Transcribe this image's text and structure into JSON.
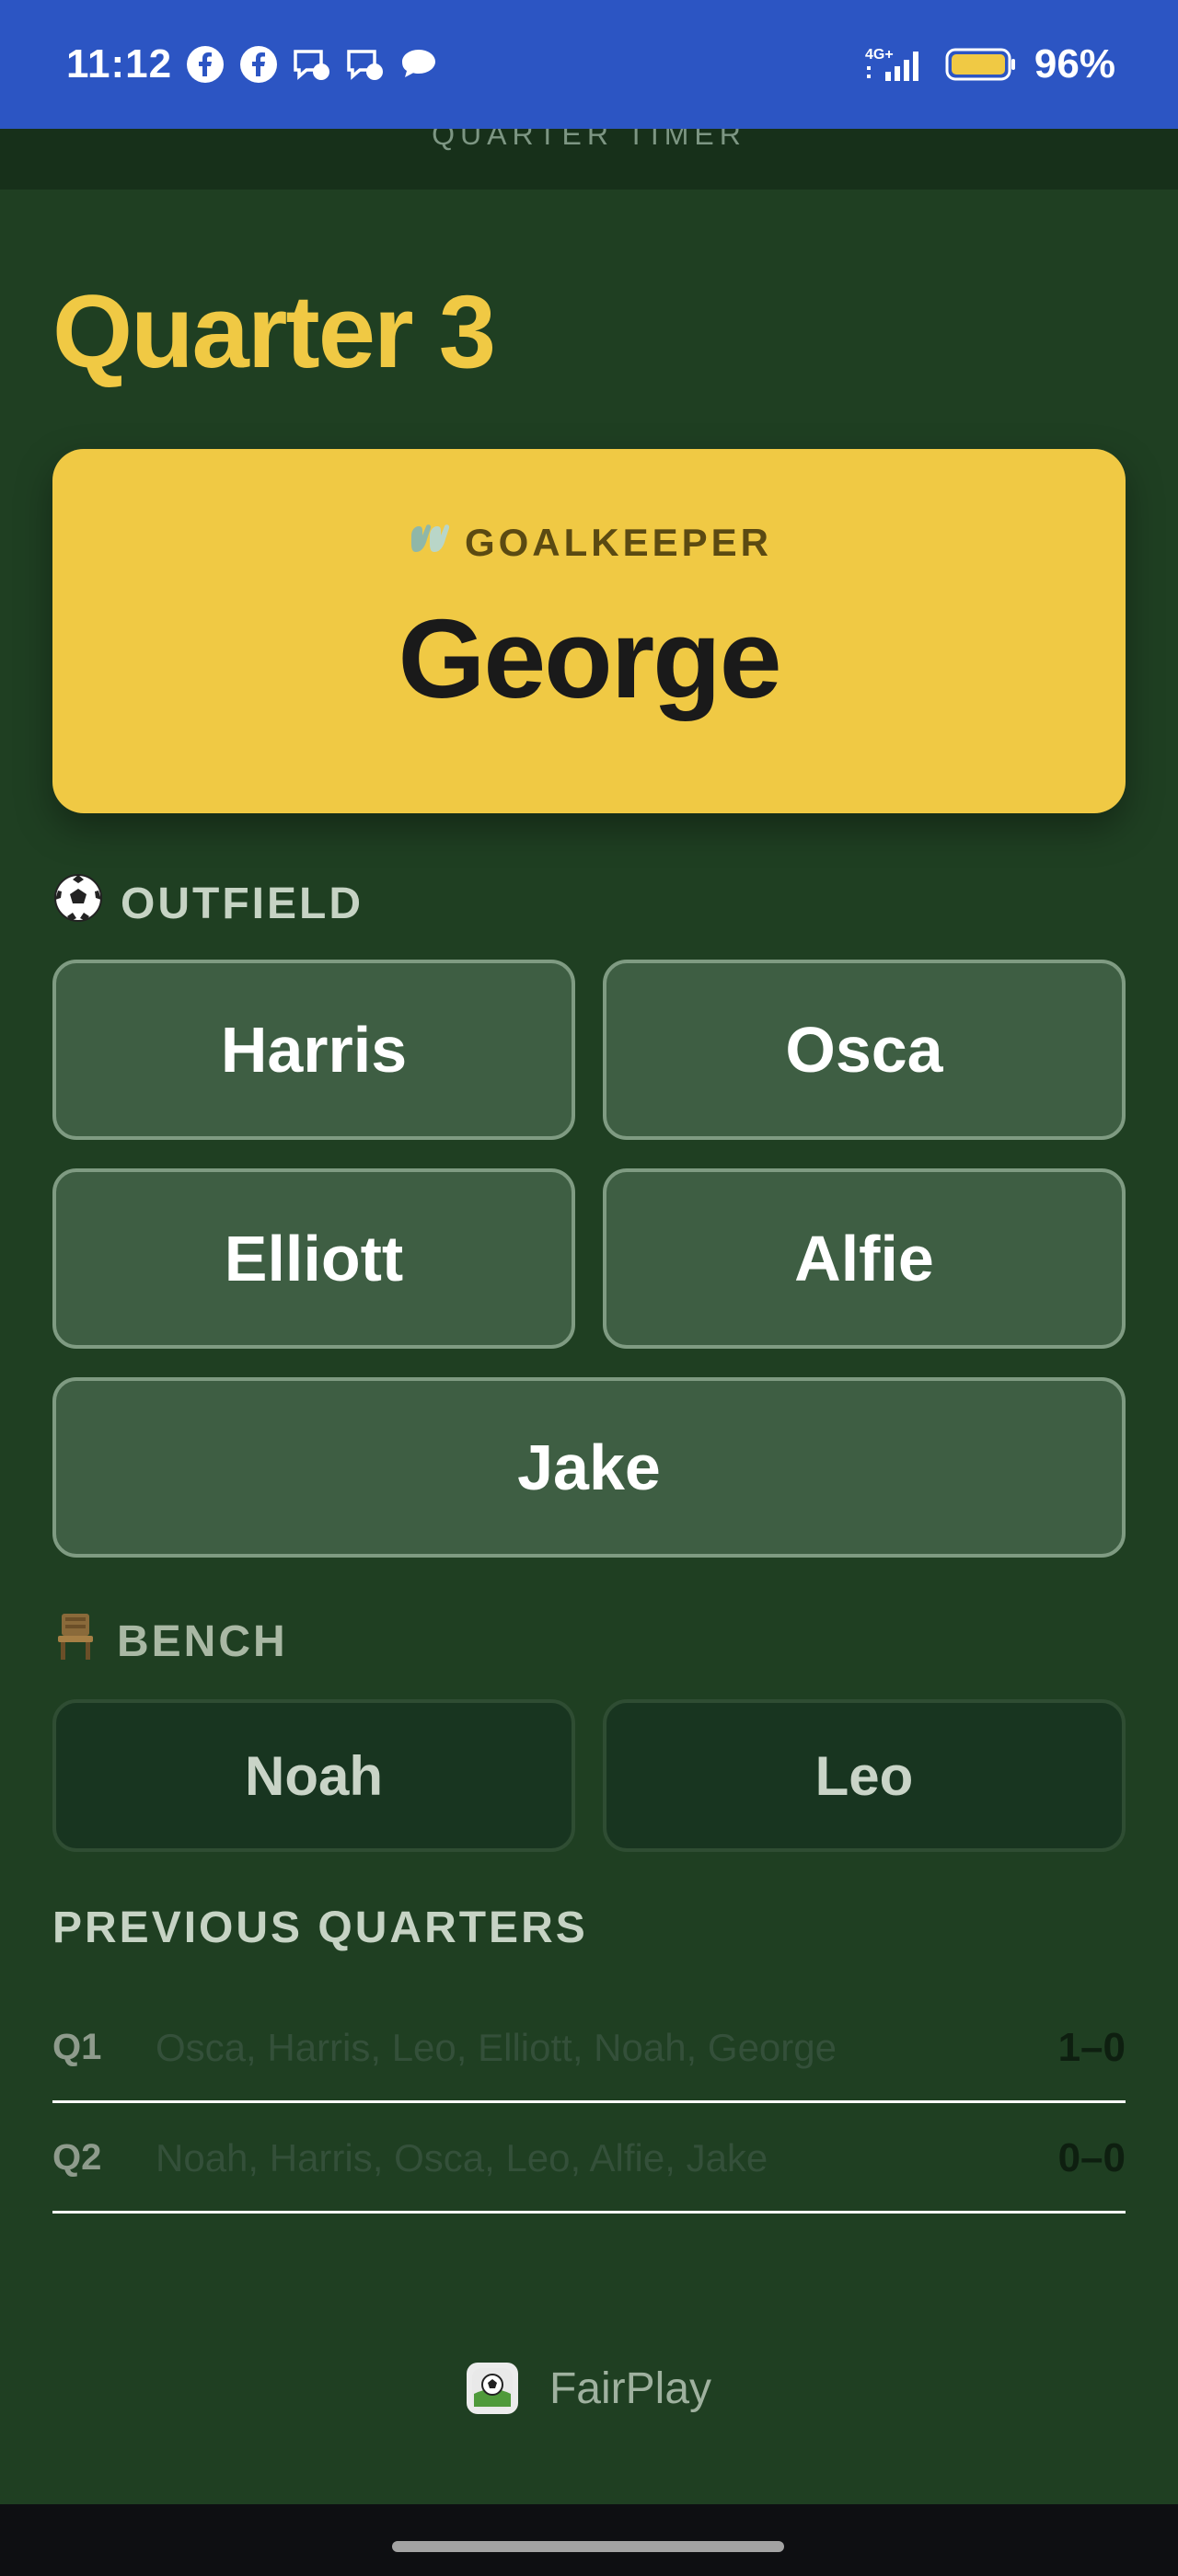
{
  "status_bar": {
    "time": "11:12",
    "battery": "96%",
    "network": "4G+",
    "notification_icons": [
      "facebook-icon",
      "facebook-icon",
      "messenger-icon",
      "messenger-icon",
      "chat-icon"
    ]
  },
  "header": {
    "title": "QUARTER TIMER"
  },
  "quarter": {
    "title": "Quarter 3"
  },
  "goalkeeper": {
    "icon": "gloves-icon",
    "label": "GOALKEEPER",
    "name": "George"
  },
  "outfield": {
    "icon": "soccer-ball-icon",
    "label": "OUTFIELD",
    "players": [
      "Harris",
      "Osca",
      "Elliott",
      "Alfie",
      "Jake"
    ]
  },
  "bench": {
    "icon": "chair-icon",
    "label": "BENCH",
    "players": [
      "Noah",
      "Leo"
    ]
  },
  "previous_quarters": {
    "title": "PREVIOUS QUARTERS",
    "rows": [
      {
        "quarter": "Q1",
        "lineup": "Osca, Harris, Leo, Elliott, Noah, George",
        "score": "1–0"
      },
      {
        "quarter": "Q2",
        "lineup": "Noah, Harris, Osca, Leo, Alfie, Jake",
        "score": "0–0"
      }
    ]
  },
  "footer": {
    "brand": "FairPlay",
    "logo_icon": "fairplay-logo-icon"
  },
  "colors": {
    "status_bar": "#2c55c3",
    "background": "#1f3f22",
    "accent_yellow": "#f0c944",
    "outfield_button": "#3e5e43",
    "bench_button": "#183520"
  }
}
